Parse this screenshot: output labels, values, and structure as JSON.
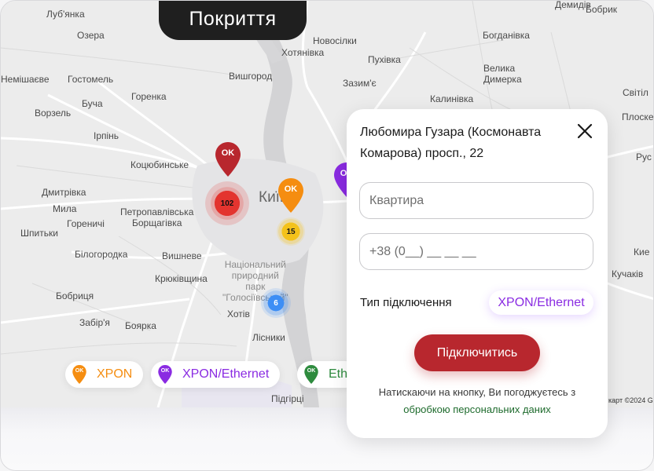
{
  "header": {
    "title": "Покриття"
  },
  "map": {
    "places": {
      "lubyanka": "Луб'янка",
      "ozera": "Озера",
      "demydiv": "Демидів",
      "novosilky": "Новосілки",
      "bogdanivka": "Богданівка",
      "bobryk": "Бобрик",
      "khotianivka": "Хотянівка",
      "pukhivka": "Пухівка",
      "hostomel": "Гостомель",
      "vyshhorod": "Вишгород",
      "zazymye": "Зазим'є",
      "velyka_dymerka": "Велика\nДимерка",
      "nemishaieve": "Немішаєве",
      "horenka": "Горенка",
      "kalynivka": "Калинівка",
      "svitil": "Світіл",
      "bucha": "Буча",
      "vorzel": "Ворзель",
      "irpin": "Ірпінь",
      "kotsiubynske": "Коцюбинське",
      "kyiv": "Київ",
      "dmytrivka": "Дмитрівка",
      "myla": "Мила",
      "horenychi": "Гореничі",
      "petropavlivska": "Петропавлівська\nБорщагівка",
      "shpytky": "Шпитьки",
      "bilohorodka": "Білогородка",
      "vyshneve": "Вишневе",
      "kriukivshchyna": "Крюківщина",
      "park": "Національний\nприродний\nпарк\n\"Голосіївський\"",
      "bobrytsia": "Бобриця",
      "zabiria": "Забір'я",
      "boiarka": "Боярка",
      "khotiv": "Хотів",
      "lisnyky": "Лісники",
      "pidhirtsi": "Підгірці",
      "kuchakiv": "Кучаків",
      "prosok": "Плоске",
      "rus": "Рус",
      "kyivska": "Кие"
    },
    "pins": [
      {
        "label": "OK",
        "color": "#b8272e"
      },
      {
        "label": "OK",
        "color": "#f58d10"
      },
      {
        "label": "OK",
        "color": "#8a2be2"
      }
    ],
    "clusters": [
      {
        "count": "102",
        "color": "#e3342f"
      },
      {
        "count": "15",
        "color": "#f4c21b"
      },
      {
        "count": "6",
        "color": "#3d8ef5"
      }
    ],
    "copyright": "карт ©2024 G"
  },
  "legend": [
    {
      "label": "XPON",
      "color": "#f58d10",
      "icon": "pin-icon"
    },
    {
      "label": "XPON/Ethernet",
      "color": "#8a2be2",
      "icon": "pin-icon"
    },
    {
      "label": "Eth",
      "color": "#2e8b3e",
      "icon": "pin-icon"
    }
  ],
  "panel": {
    "address": "Любомира Гузара (Космонавта Комарова) просп., 22",
    "apartment_placeholder": "Квартира",
    "phone_placeholder": "+38 (0__) __ __ __",
    "connection_type_label": "Тип підключення",
    "connection_type_value": "XPON/Ethernet",
    "connect_button": "Підключитись",
    "consent_text": "Натискаючи на кнопку, Ви погоджуєтесь з",
    "consent_link": "обробкою персональних даних"
  }
}
